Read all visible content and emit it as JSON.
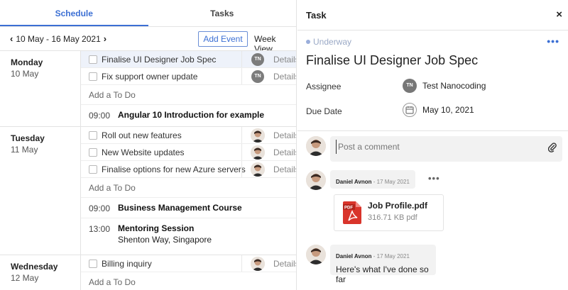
{
  "tabs": [
    {
      "label": "Schedule",
      "active": true
    },
    {
      "label": "Tasks",
      "active": false
    }
  ],
  "toolbar": {
    "range": "10 May - 16 May 2021",
    "add_event": "Add Event",
    "view": "Week View"
  },
  "days": [
    {
      "name": "Monday",
      "date": "10 May",
      "todos": [
        {
          "text": "Finalise UI Designer Job Spec",
          "assignee": "TN",
          "details": "Details",
          "selected": true
        },
        {
          "text": "Fix support owner update",
          "assignee": "TN",
          "details": "Details"
        }
      ],
      "add_todo": "Add a To Do",
      "events": [
        {
          "time": "09:00",
          "title": "Angular 10 Introduction for example"
        }
      ]
    },
    {
      "name": "Tuesday",
      "date": "11 May",
      "todos": [
        {
          "text": "Roll out new features",
          "assignee": "photo",
          "details": "Details"
        },
        {
          "text": "New Website updates",
          "assignee": "photo",
          "details": "Details"
        },
        {
          "text": "Finalise options for new Azure servers",
          "assignee": "photo",
          "details": "Details"
        }
      ],
      "add_todo": "Add a To Do",
      "events": [
        {
          "time": "09:00",
          "title": "Business Management Course"
        },
        {
          "time": "13:00",
          "title": "Mentoring Session",
          "subtitle": "Shenton Way, Singapore"
        }
      ]
    },
    {
      "name": "Wednesday",
      "date": "12 May",
      "todos": [
        {
          "text": "Billing inquiry",
          "assignee": "photo",
          "details": "Details"
        }
      ],
      "add_todo": "Add a To Do"
    }
  ],
  "task": {
    "header": "Task",
    "close": "×",
    "status": "Underway",
    "more": "•••",
    "title": "Finalise UI Designer Job Spec",
    "assignee_label": "Assignee",
    "assignee_initials": "TN",
    "assignee_name": "Test Nanocoding",
    "due_label": "Due Date",
    "due_date": "May 10, 2021",
    "comment_placeholder": "Post a comment",
    "comments": [
      {
        "author": "Daniel Avnon",
        "date": " - 17 May 2021",
        "more": "•••",
        "file": {
          "name": "Job Profile.pdf",
          "size": "316.71 KB pdf",
          "type": "PDF"
        }
      },
      {
        "author": "Daniel Avnon",
        "date": " - 17 May 2021",
        "text": "Here's what I've done so far"
      }
    ]
  },
  "colors": {
    "accent": "#3b6fd4",
    "status": "#9aaedb",
    "pdf": "#d9342b"
  }
}
